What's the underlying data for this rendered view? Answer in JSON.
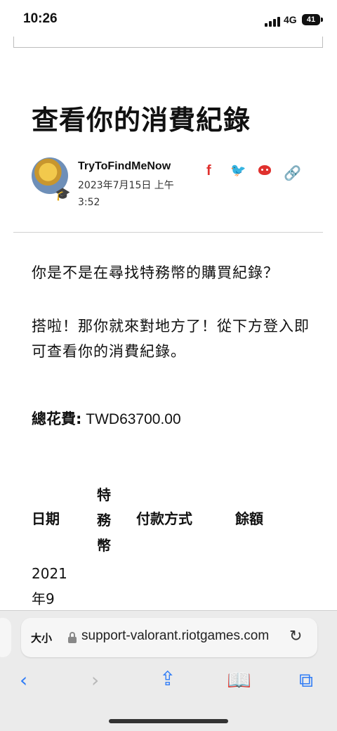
{
  "status_bar": {
    "time": "10:26",
    "network": "4G",
    "battery": "41"
  },
  "article": {
    "title": "查看你的消費紀錄",
    "author": "TryToFindMeNow",
    "date": "2023年7月15日 上午 3:52",
    "share_icons": [
      "facebook-icon",
      "twitter-icon",
      "reddit-icon",
      "link-icon"
    ],
    "paragraph1": "你是不是在尋找特務幣的購買紀錄？",
    "paragraph2": "搭啦！那你就來對地方了！從下方登入即可查看你的消費紀錄。",
    "total_label": "總花費:",
    "total_value": "TWD63700.00",
    "table": {
      "headers": [
        "日期",
        "特務幣",
        "付款方式",
        "餘額"
      ],
      "rows": [
        {
          "date": "2021年9"
        }
      ]
    }
  },
  "browser": {
    "text_size_label": "大小",
    "url": "support-valorant.riotgames.com"
  },
  "colors": {
    "share_red": "#e0312e",
    "ios_blue": "#2f7cf6"
  }
}
